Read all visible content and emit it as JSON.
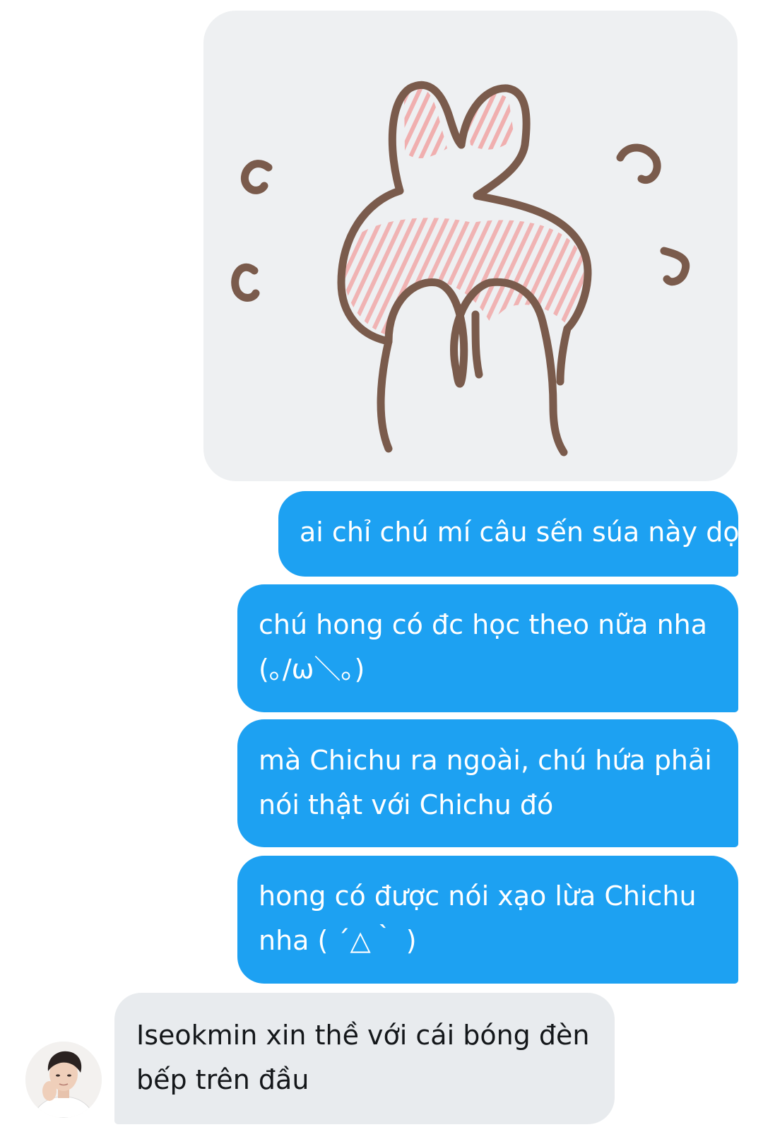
{
  "conversation": {
    "messages": [
      {
        "direction": "outgoing",
        "lines": [
          "ai chỉ chú mí câu sến súa này dọ"
        ]
      },
      {
        "direction": "outgoing",
        "lines": [
          "chú hong có đc học theo nữa nha",
          "(｡/ω＼｡)"
        ]
      },
      {
        "direction": "outgoing",
        "lines": [
          "mà Chichu ra ngoài, chú hứa phải",
          "nói thật với Chichu đó"
        ]
      },
      {
        "direction": "outgoing",
        "lines": [
          "hong có được nói xạo lừa Chichu",
          "nha ( ´△｀ )"
        ]
      },
      {
        "direction": "incoming",
        "lines": [
          "Iseokmin xin thề với cái bóng đèn",
          "bếp trên đầu"
        ]
      }
    ]
  },
  "sticker": {
    "icon": "bunny-ears-shy-sticker"
  },
  "avatar": {
    "icon": "user-avatar-photo"
  },
  "colors": {
    "outgoing_bubble": "#1da1f2",
    "incoming_bubble": "#e8ebee",
    "sticker_bubble": "#eef0f2",
    "outgoing_text": "#ffffff",
    "incoming_text": "#14171a",
    "sticker_outline": "#7a5b4c",
    "sticker_blush": "#f0a8a8"
  }
}
